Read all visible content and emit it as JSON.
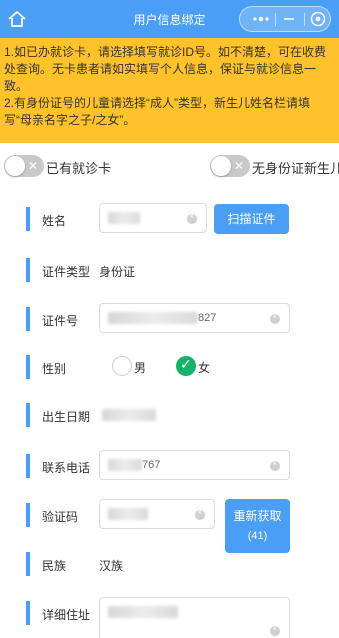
{
  "header": {
    "title": "用户信息绑定",
    "capsule": {
      "menu": "•••",
      "minimize": "—"
    }
  },
  "notice": {
    "line1": "1.如已办就诊卡，请选择填写就诊ID号。如不清楚，可在收费处查询。无卡患者请如实填写个人信息，保证与就诊信息一致。",
    "line2": "2.有身份证号的儿童请选择“成人”类型，新生儿姓名栏请填写“母亲名字之子/之女”。"
  },
  "toggles": {
    "has_card": {
      "label": "已有就诊卡",
      "on": false
    },
    "newborn": {
      "label": "无身份证新生儿",
      "on": false
    }
  },
  "form": {
    "name": {
      "label": "姓名",
      "scan_button": "扫描证件"
    },
    "id_type": {
      "label": "证件类型",
      "value": "身份证"
    },
    "id_number": {
      "label": "证件号",
      "value_tail": "827"
    },
    "gender": {
      "label": "性别",
      "male": "男",
      "female": "女",
      "selected": "女"
    },
    "birth": {
      "label": "出生日期"
    },
    "phone": {
      "label": "联系电话",
      "value_tail": "767"
    },
    "code": {
      "label": "验证码",
      "resend_label": "重新获取",
      "countdown": "(41)"
    },
    "ethnicity": {
      "label": "民族",
      "value": "汉族"
    },
    "address": {
      "label": "详细住址"
    }
  },
  "colors": {
    "primary": "#4a9ef5",
    "notice_bg": "#ffc22a",
    "check": "#17b26a"
  }
}
